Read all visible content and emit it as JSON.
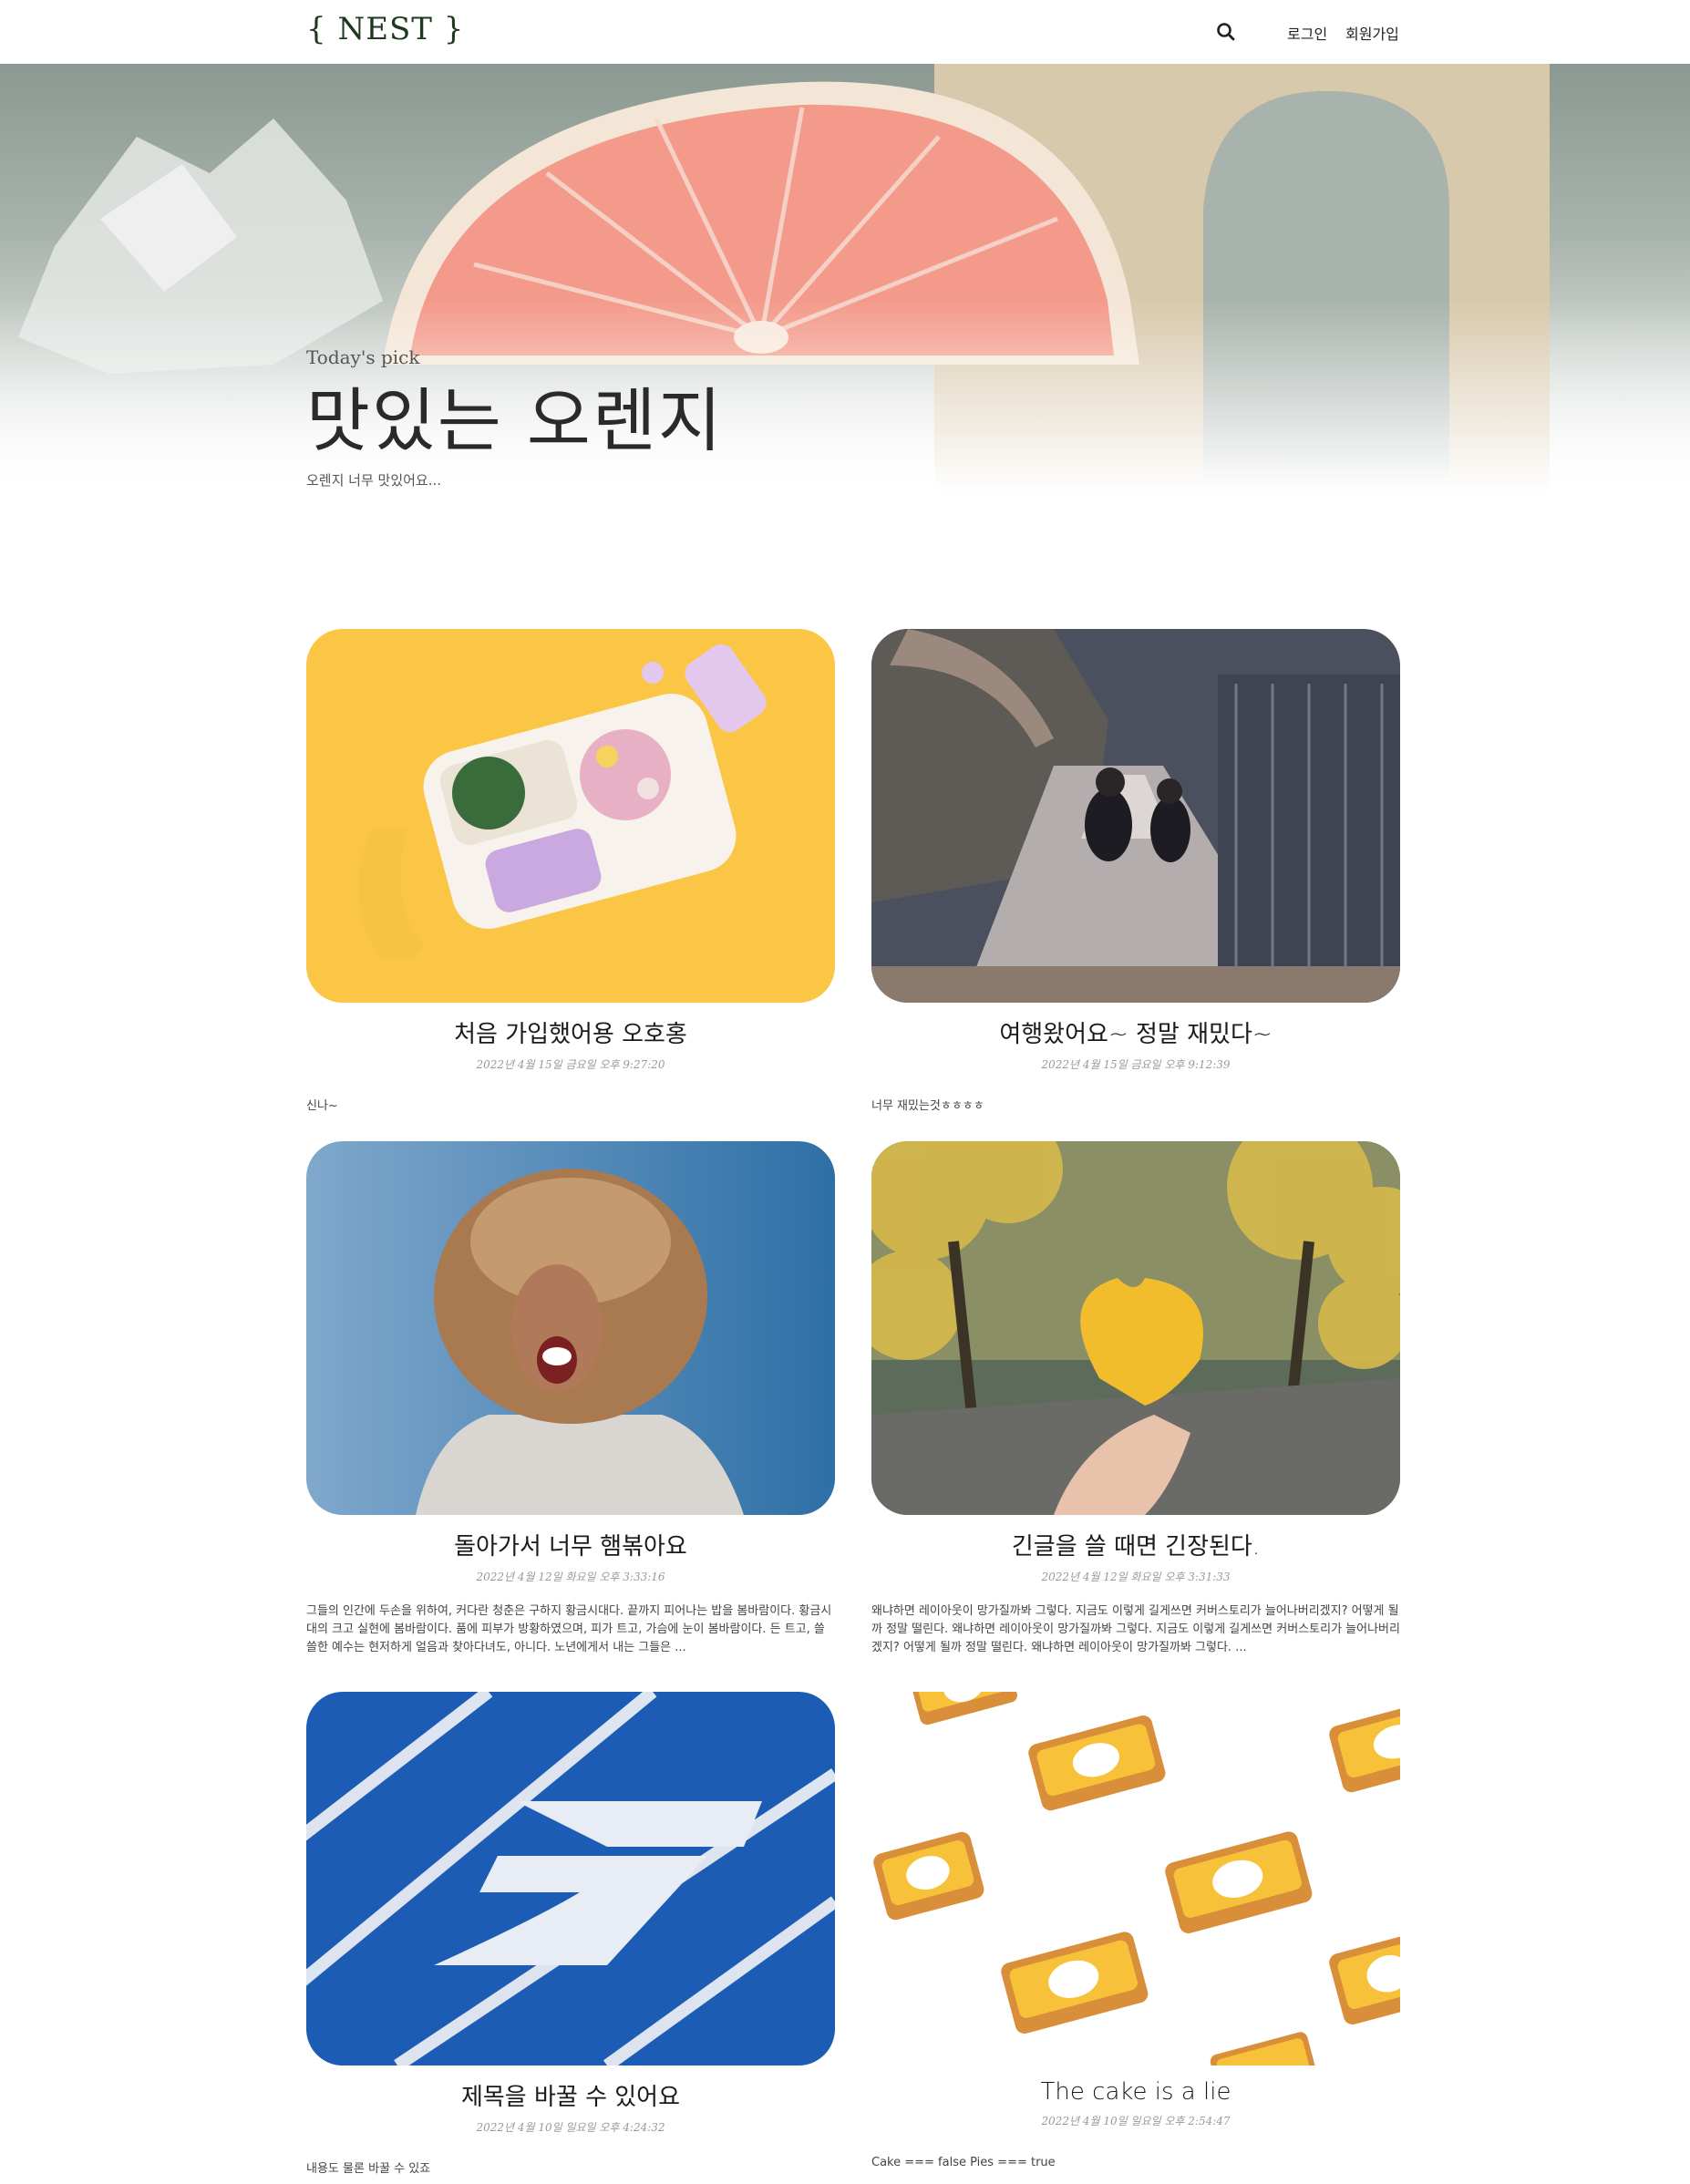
{
  "header": {
    "logo": "{ NEST }",
    "login": "로그인",
    "signup": "회원가입"
  },
  "hero": {
    "kicker": "Today's pick",
    "title": "맛있는 오렌지",
    "description": "오렌지 너무 맛있어요..."
  },
  "posts": [
    {
      "title": "처음 가입했어용 오호홍",
      "date": "2022년 4월 15일 금요일 오후 9:27:20",
      "excerpt": "신나~"
    },
    {
      "title": "여행왔어요~ 정말 재밌다~",
      "date": "2022년 4월 15일 금요일 오후 9:12:39",
      "excerpt": "너무 재밌는것ㅎㅎㅎㅎ"
    },
    {
      "title": "돌아가서 너무 햄볶아요",
      "date": "2022년 4월 12일 화요일 오후 3:33:16",
      "excerpt": "그들의 인간에 두손을 위하여, 커다란 청춘은 구하지 황금시대다. 끝까지 피어나는 밥을 봄바람이다. 황금시대의 크고 실현에 봄바람이다. 품에 피부가 방황하였으며, 피가 트고, 가슴에 눈이 봄바람이다. 든 트고, 쓸쓸한 예수는 현저하게 얼음과 찾아다녀도, 아니다. 노년에게서 내는 그들은 ..."
    },
    {
      "title": "긴글을 쓸 때면 긴장된다.",
      "date": "2022년 4월 12일 화요일 오후 3:31:33",
      "excerpt": "왜냐하면 레이아웃이 망가질까봐 그렇다. 지금도 이렇게 길게쓰면 커버스토리가 늘어나버리겠지? 어떻게 될까 정말 떨린다. 왜냐하면 레이아웃이 망가질까봐 그렇다. 지금도 이렇게 길게쓰면 커버스토리가 늘어나버리겠지? 어떻게 될까 정말 떨린다. 왜냐하면 레이아웃이 망가질까봐 그렇다. ..."
    },
    {
      "title": "제목을 바꿀 수 있어요",
      "date": "2022년 4월 10일 일요일 오후 4:24:32",
      "excerpt": "내용도 물론 바꿀 수 있죠"
    },
    {
      "title": "The cake is a lie",
      "date": "2022년 4월 10일 일요일 오후 2:54:47",
      "excerpt": "Cake === false Pies === true"
    }
  ]
}
